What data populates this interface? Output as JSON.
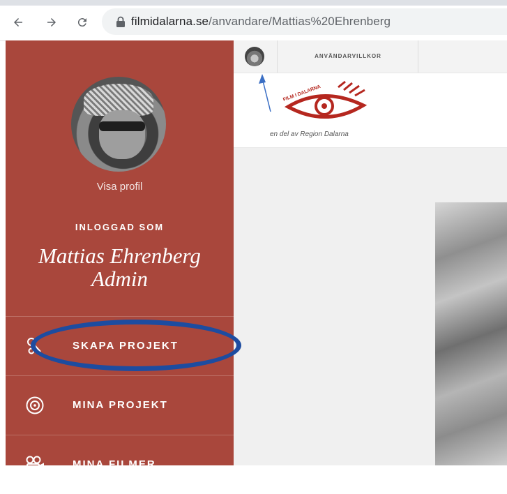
{
  "browser": {
    "url_domain": "filmidalarna.se",
    "url_path": "/anvandare/Mattias%20Ehrenberg"
  },
  "sidebar": {
    "profile_link": "Visa profil",
    "logged_in_label": "INLOGGAD SOM",
    "user_name": "Mattias Ehrenberg",
    "user_role": "Admin",
    "menu": [
      {
        "label": "SKAPA PROJEKT",
        "icon": "tools-icon"
      },
      {
        "label": "MINA PROJEKT",
        "icon": "film-reel-icon"
      },
      {
        "label": "MINA FILMER",
        "icon": "camera-icon"
      }
    ]
  },
  "topnav": {
    "terms_link": "ANVÄNDARVILLKOR"
  },
  "header": {
    "logo_text": "FILM I DALARNA",
    "tagline": "en del av Region Dalarna"
  },
  "colors": {
    "sidebar_bg": "#a9473c",
    "annotation": "#1d4ca0",
    "logo_red": "#b5271f"
  }
}
